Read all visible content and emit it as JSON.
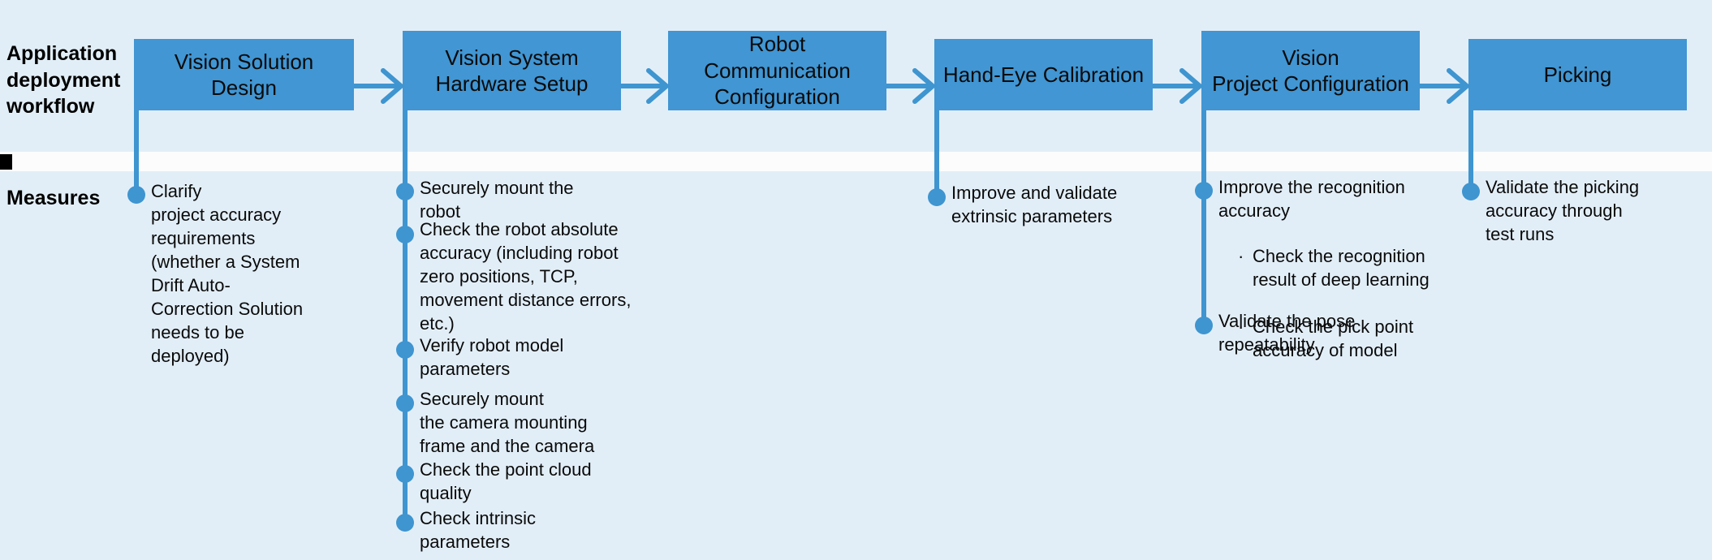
{
  "rows": {
    "workflow_label": "Application\ndeployment\nworkflow",
    "measures_label": "Measures"
  },
  "colors": {
    "background": "#e2eef7",
    "box_fill": "#4196d3",
    "connector": "#3e95d0",
    "separator": "#fcfcfd",
    "marker": "#000000",
    "text": "#0a0a0a"
  },
  "stages": [
    {
      "id": "vision-solution-design",
      "label": "Vision Solution Design"
    },
    {
      "id": "vision-system-hardware-setup",
      "label": "Vision System\nHardware Setup"
    },
    {
      "id": "robot-communication-configuration",
      "label": "Robot\nCommunication\nConfiguration"
    },
    {
      "id": "hand-eye-calibration",
      "label": "Hand-Eye Calibration"
    },
    {
      "id": "vision-project-configuration",
      "label": "Vision\nProject Configuration"
    },
    {
      "id": "picking",
      "label": "Picking"
    }
  ],
  "measures": [
    {
      "stage": "vision-solution-design",
      "items": [
        {
          "text": "Clarify\nproject accuracy\nrequirements\n (whether a System\nDrift Auto-\nCorrection Solution\nneeds to be\ndeployed)",
          "subitems": []
        }
      ]
    },
    {
      "stage": "vision-system-hardware-setup",
      "items": [
        {
          "text": "Securely mount the\nrobot",
          "subitems": []
        },
        {
          "text": "Check the robot absolute\naccuracy (including robot\nzero positions, TCP,\nmovement distance errors,\netc.)",
          "subitems": []
        },
        {
          "text": "Verify robot model\nparameters",
          "subitems": []
        },
        {
          "text": "Securely mount\nthe camera mounting\nframe and the camera",
          "subitems": []
        },
        {
          "text": "Check the point cloud\nquality",
          "subitems": []
        },
        {
          "text": "Check intrinsic\nparameters",
          "subitems": []
        }
      ]
    },
    {
      "stage": "robot-communication-configuration",
      "items": []
    },
    {
      "stage": "hand-eye-calibration",
      "items": [
        {
          "text": "Improve and validate\nextrinsic parameters",
          "subitems": []
        }
      ]
    },
    {
      "stage": "vision-project-configuration",
      "items": [
        {
          "text": "Improve the recognition\naccuracy",
          "subitems": [
            "Check the recognition\nresult of deep learning",
            "Check the pick point\naccuracy of model"
          ]
        },
        {
          "text": "Validate the pose\nrepeatability",
          "subitems": []
        }
      ]
    },
    {
      "stage": "picking",
      "items": [
        {
          "text": "Validate the picking\naccuracy through\ntest runs",
          "subitems": []
        }
      ]
    }
  ]
}
